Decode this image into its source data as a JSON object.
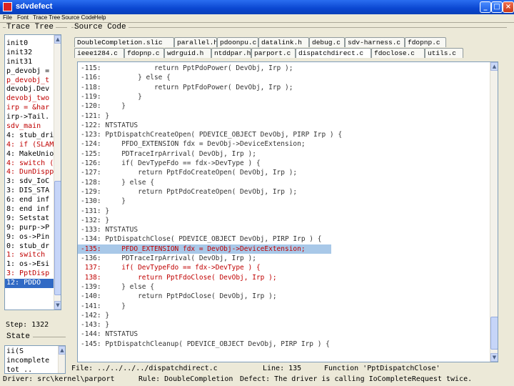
{
  "window": {
    "title": "sdvdefect",
    "min_label": "_",
    "max_label": "□",
    "close_label": "×"
  },
  "menu": [
    "File",
    "Font",
    "Trace Tree",
    "Source Code",
    "Help"
  ],
  "trace_tree": {
    "title": "Trace Tree",
    "rows": [
      {
        "text": "init0",
        "color": "black"
      },
      {
        "text": "init32",
        "color": "black"
      },
      {
        "text": "init31",
        "color": "black"
      },
      {
        "text": "p_devobj =",
        "color": "black"
      },
      {
        "text": "p_devobj_t",
        "color": "red"
      },
      {
        "text": "devobj.Dev",
        "color": "black"
      },
      {
        "text": "devobj_two",
        "color": "red"
      },
      {
        "text": "irp = &har",
        "color": "red"
      },
      {
        "text": "irp->Tail.",
        "color": "black"
      },
      {
        "text": "sdv_main",
        "color": "red"
      },
      {
        "text": "4: stub_dri",
        "color": "black"
      },
      {
        "text": "4: if (SLAM",
        "color": "red"
      },
      {
        "text": "4: MakeUnio",
        "color": "black"
      },
      {
        "text": "4: switch (",
        "color": "red"
      },
      {
        "text": "4: DunDispp",
        "color": "red"
      },
      {
        "text": "3: sdv_IoC",
        "color": "black"
      },
      {
        "text": "3: DIS_STA",
        "color": "black"
      },
      {
        "text": "6: end inf",
        "color": "black"
      },
      {
        "text": "8: end inf",
        "color": "black"
      },
      {
        "text": "9: Setstat",
        "color": "black"
      },
      {
        "text": "9: purp->P",
        "color": "black"
      },
      {
        "text": "9: os->Pin",
        "color": "black"
      },
      {
        "text": "0: stub_dr",
        "color": "black"
      },
      {
        "text": "1: switch",
        "color": "red"
      },
      {
        "text": "1: os->Esi",
        "color": "black"
      },
      {
        "text": "3: PptDisp",
        "color": "red"
      },
      {
        "text": "12: PDDO",
        "color": "selected"
      }
    ],
    "step_label": "Step: 1322"
  },
  "state": {
    "title": "State",
    "rows": [
      "ii(S",
      "incomplete",
      "tot .."
    ]
  },
  "source_code": {
    "title": "Source Code",
    "tabs_row1": [
      "DoubleCompletion.slic",
      "parallel.h",
      "pdoonpu.c",
      "datalink.h",
      "debug.c",
      "sdv-harness.c",
      "fdopnp.c"
    ],
    "tabs_row2": [
      "ieee1284.c",
      "fdopnp.c",
      "wdrguid.h",
      "ntddpar.h",
      "parport.c",
      "dispatchdirect.c",
      "fdoclose.c",
      "utils.c"
    ],
    "active_tab": "dispatchdirect.c",
    "lines": [
      {
        "text": "-115:             return PptPdoPower( DevObj, Irp );",
        "style": "normal"
      },
      {
        "text": "-116:         } else {",
        "style": "normal"
      },
      {
        "text": "-118:             return PptFdoPower( DevObj, Irp );",
        "style": "normal"
      },
      {
        "text": "-119:         }",
        "style": "normal"
      },
      {
        "text": "-120:     }",
        "style": "normal"
      },
      {
        "text": "-121: }",
        "style": "normal"
      },
      {
        "text": "-122: NTSTATUS",
        "style": "normal"
      },
      {
        "text": "-123: PptDispatchCreateOpen( PDEVICE_OBJECT DevObj, PIRP Irp ) {",
        "style": "normal"
      },
      {
        "text": "-124:     PFDO_EXTENSION fdx = DevObj->DeviceExtension;",
        "style": "normal"
      },
      {
        "text": "-125:     PDTraceIrpArrival( DevObj, Irp );",
        "style": "normal"
      },
      {
        "text": "-126:     if( DevTypeFdo == fdx->DevType ) {",
        "style": "normal"
      },
      {
        "text": "-127:         return PptFdoCreateOpen( DevObj, Irp );",
        "style": "normal"
      },
      {
        "text": "-128:     } else {",
        "style": "normal"
      },
      {
        "text": "-129:         return PptPdoCreateOpen( DevObj, Irp );",
        "style": "normal"
      },
      {
        "text": "-130:     }",
        "style": "normal"
      },
      {
        "text": "-131: }",
        "style": "normal"
      },
      {
        "text": "-132: }",
        "style": "normal"
      },
      {
        "text": "-133: NTSTATUS",
        "style": "normal"
      },
      {
        "text": "-134: PptDispatchClose( PDEVICE_OBJECT DevObj, PIRP Irp ) {",
        "style": "normal"
      },
      {
        "text": "-135:     PFDO_EXTENSION fdx = DevObj->DeviceExtension;",
        "style": "current"
      },
      {
        "text": "-136:     PDTraceIrpArrival( DevObj, Irp );",
        "style": "normal"
      },
      {
        "text": " 137:     if( DevTypeFdo == fdx->DevType ) {",
        "style": "red"
      },
      {
        "text": " 138:         return PptFdoClose( DevObj, Irp );",
        "style": "red"
      },
      {
        "text": "-139:     } else {",
        "style": "normal"
      },
      {
        "text": "-140:         return PptPdoClose( DevObj, Irp );",
        "style": "normal"
      },
      {
        "text": "-141:     }",
        "style": "normal"
      },
      {
        "text": "-142: }",
        "style": "normal"
      },
      {
        "text": "-143: }",
        "style": "normal"
      },
      {
        "text": "-144: NTSTATUS",
        "style": "normal"
      },
      {
        "text": "-145: PptDispatchCleanup( PDEVICE_OBJECT DevObj, PIRP Irp ) {",
        "style": "normal"
      }
    ]
  },
  "status": {
    "file": "File: ../../../../dispatchdirect.c",
    "line": "Line: 135",
    "function": "Function 'PptDispatchClose'",
    "driver": "Driver: src\\kernel\\parport",
    "rule": "Rule: DoubleCompletion",
    "defect": "Defect: The driver is calling IoCompleteRequest twice."
  },
  "colors": {
    "title_bar": "#0a46d0",
    "highlight": "#a8c8e8",
    "red_text": "#c00000",
    "selection": "#316ac5"
  }
}
